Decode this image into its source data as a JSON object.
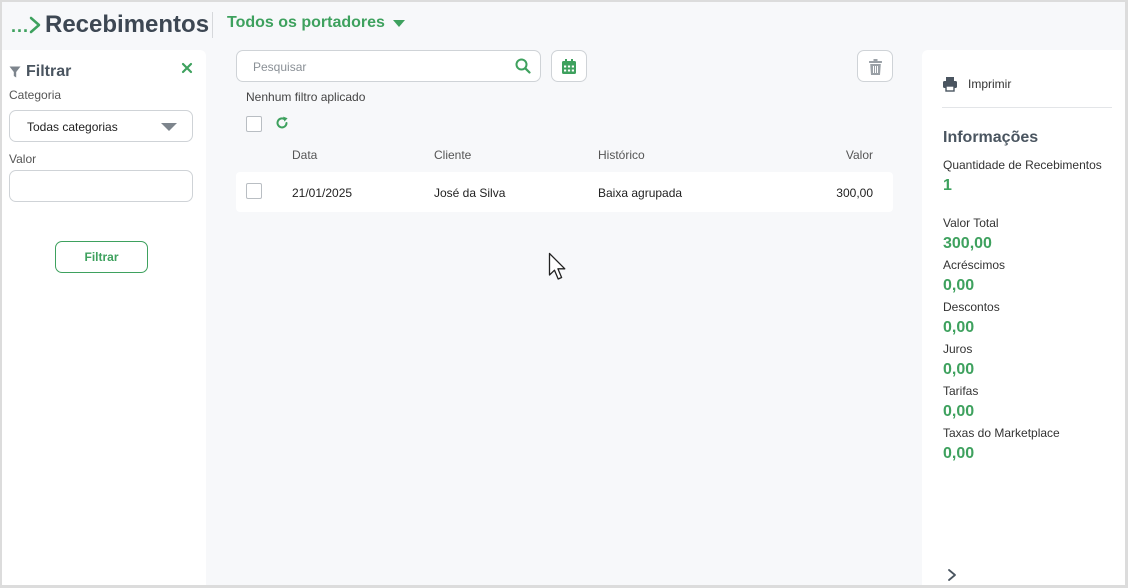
{
  "header": {
    "breadcrumb_dots": "...",
    "title": "Recebimentos",
    "portador": "Todos os portadores"
  },
  "filter": {
    "title": "Filtrar",
    "categoria_label": "Categoria",
    "categoria_value": "Todas categorias",
    "valor_label": "Valor",
    "valor_value": "",
    "button": "Filtrar"
  },
  "main": {
    "search_placeholder": "Pesquisar",
    "no_filter_text": "Nenhum filtro aplicado",
    "columns": [
      "Data",
      "Cliente",
      "Histórico",
      "Valor"
    ],
    "rows": [
      {
        "data": "21/01/2025",
        "cliente": "José da Silva",
        "historico": "Baixa agrupada",
        "valor": "300,00"
      }
    ]
  },
  "info": {
    "print_label": "Imprimir",
    "title": "Informações",
    "items": [
      {
        "label": "Quantidade de Recebimentos",
        "value": "1"
      },
      {
        "label": "Valor Total",
        "value": "300,00"
      },
      {
        "label": "Acréscimos",
        "value": "0,00"
      },
      {
        "label": "Descontos",
        "value": "0,00"
      },
      {
        "label": "Juros",
        "value": "0,00"
      },
      {
        "label": "Tarifas",
        "value": "0,00"
      },
      {
        "label": "Taxas do Marketplace",
        "value": "0,00"
      }
    ]
  },
  "colors": {
    "accent": "#3ea15e",
    "title": "#3d4753",
    "border": "#cfd3d7",
    "background": "#f7f8fa"
  },
  "icons": [
    "chevron-right-icon",
    "caret-down-icon",
    "filter-icon",
    "close-icon",
    "search-icon",
    "calendar-icon",
    "trash-icon",
    "refresh-icon",
    "printer-icon",
    "mouse-cursor-icon"
  ]
}
